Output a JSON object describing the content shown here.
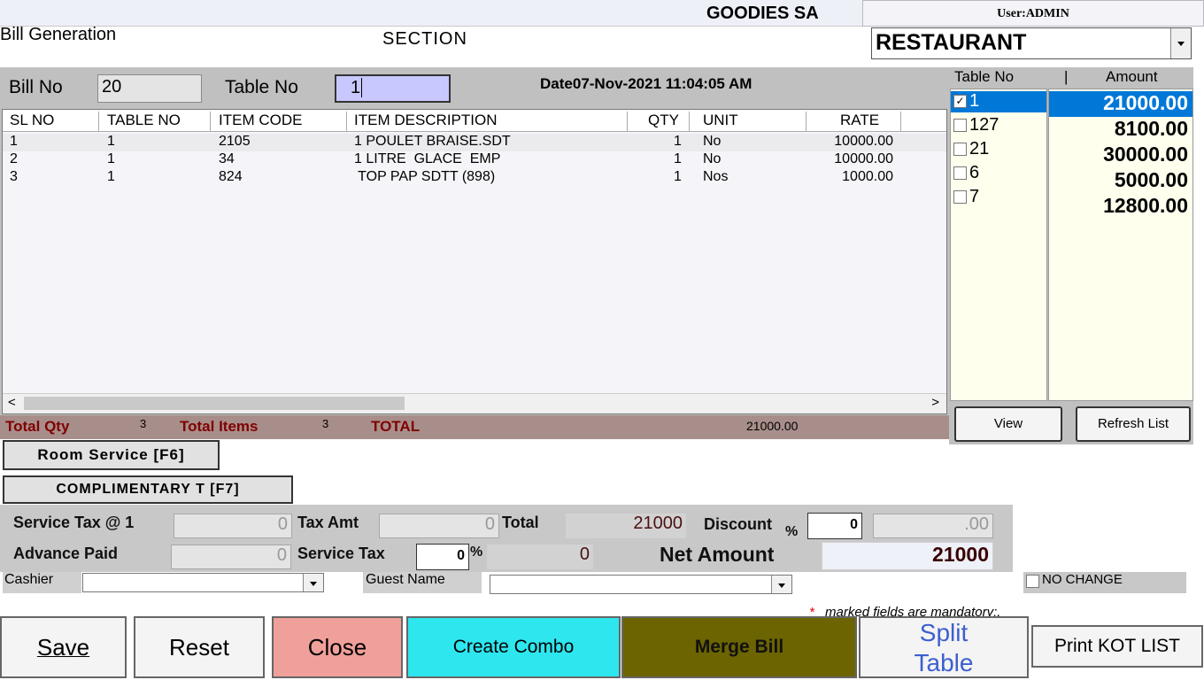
{
  "window": {
    "app_title": "GOODIES SA",
    "user_label": "User:ADMIN"
  },
  "form": {
    "title": "Bill Generation",
    "section_label": "SECTION",
    "section_value": "RESTAURANT"
  },
  "bill": {
    "bill_no_label": "Bill No",
    "bill_no": "20",
    "table_no_label": "Table No",
    "table_no": "1",
    "date_label": "Date",
    "date_value": "07-Nov-2021 11:04:05 AM"
  },
  "grid": {
    "headers": [
      "SL NO",
      "TABLE NO",
      "ITEM CODE",
      "ITEM DESCRIPTION",
      "QTY",
      "UNIT",
      "RATE"
    ],
    "rows": [
      [
        "1",
        "1",
        "2105",
        "1 POULET BRAISE.SDT",
        "1",
        "No",
        "10000.00"
      ],
      [
        "2",
        "1",
        "34",
        "1 LITRE  GLACE  EMP",
        "1",
        "No",
        "10000.00"
      ],
      [
        "3",
        "1",
        "824",
        " TOP PAP SDTT (898)",
        "1",
        "Nos",
        "1000.00"
      ]
    ],
    "scroll_left": "<",
    "scroll_right": ">"
  },
  "totals": {
    "total_qty_label": "Total Qty",
    "total_qty": "3",
    "total_items_label": "Total Items",
    "total_items": "3",
    "total_label": "TOTAL",
    "total_value": "21000.00"
  },
  "actions": {
    "room_service": "Room Service [F6]",
    "complimentary": "COMPLIMENTARY T  [F7]"
  },
  "tax": {
    "service_tax_label": "Service Tax @ 1",
    "service_tax_value": "0",
    "tax_amt_label": "Tax Amt",
    "tax_amt_value": "0",
    "total_label": "Total",
    "total_value": "21000",
    "discount_label": "Discount",
    "discount_pct_sign": "%",
    "discount_pct": "0",
    "discount_amt": ".00",
    "advance_paid_label": "Advance Paid",
    "advance_paid_value": "0",
    "service_tax2_label": "Service Tax",
    "service_tax2_pct": "0",
    "service_tax2_pct_sign": "%",
    "service_tax2_amt": "0",
    "net_amount_label": "Net Amount",
    "net_amount_value": "21000"
  },
  "footer_fields": {
    "cashier_label": "Cashier",
    "cashier_value": "",
    "guest_label": "Guest Name",
    "guest_value": "",
    "no_change_label": "NO CHANGE",
    "mandatory_star": "*",
    "mandatory_note": "marked fields are mandatory:."
  },
  "side": {
    "col_table": "Table No",
    "col_sep": "|",
    "col_amount": "Amount",
    "tables": [
      {
        "no": "1",
        "checked": true,
        "amount": "21000.00"
      },
      {
        "no": "127",
        "checked": false,
        "amount": "8100.00"
      },
      {
        "no": "21",
        "checked": false,
        "amount": "30000.00"
      },
      {
        "no": "6",
        "checked": false,
        "amount": "5000.00"
      },
      {
        "no": "7",
        "checked": false,
        "amount": "12800.00"
      }
    ],
    "view_button": "View",
    "refresh_button": "Refresh List"
  },
  "buttons": {
    "save": "Save",
    "reset": "Reset",
    "close": "Close",
    "create_combo": "Create Combo",
    "merge_bill": "Merge Bill",
    "split_table_line1": "Split",
    "split_table_line2": "Table",
    "print_kot": "Print KOT LIST"
  },
  "colors": {
    "totals_bar": "#a88e8a",
    "totals_text": "#800000",
    "selected": "#0078d7",
    "close_bg": "#f0a09a",
    "create_combo_bg": "#2ee6ee",
    "merge_bill_bg": "#6b6400",
    "split_table_text": "#3d5fd0",
    "table_no_input": "#c8c8ff"
  }
}
